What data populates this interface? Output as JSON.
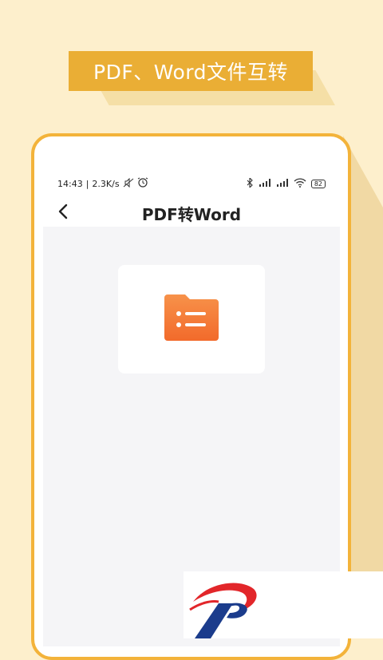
{
  "banner": {
    "title": "PDF、Word文件互转"
  },
  "status_bar": {
    "time": "14:43",
    "network_speed": "2.3K/s",
    "battery_level": "82"
  },
  "header": {
    "title": "PDF转Word"
  },
  "icons": {
    "back": "chevron-left-icon",
    "folder": "folder-list-icon",
    "bluetooth": "bluetooth-icon",
    "wifi": "wifi-icon",
    "alarm": "alarm-icon",
    "mute": "mute-icon"
  },
  "colors": {
    "background": "#fdefcc",
    "banner": "#eaae35",
    "frame": "#f3b33a",
    "folder": "#f47a35",
    "screen_bg": "#f5f5f7"
  }
}
